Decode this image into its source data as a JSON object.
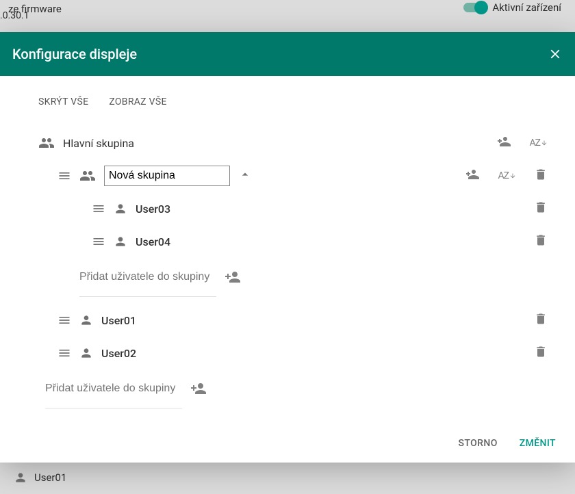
{
  "background": {
    "firmware_label": "ze firmware",
    "version": ".0.30.1",
    "active_device": "Aktivní zařízení",
    "bottom_user": "User01"
  },
  "modal": {
    "title": "Konfigurace displeje",
    "hide_all": "SKRÝT VŠE",
    "show_all": "ZOBRAZ VŠE",
    "main_group": "Hlavní skupina",
    "sub_group_value": "Nová skupina",
    "users_nested": [
      {
        "name": "User03"
      },
      {
        "name": "User04"
      }
    ],
    "users_main": [
      {
        "name": "User01"
      },
      {
        "name": "User02"
      }
    ],
    "add_user_placeholder": "Přidat uživatele do skupiny",
    "sort_label": "AZ",
    "cancel": "STORNO",
    "confirm": "ZMĚNIT"
  }
}
